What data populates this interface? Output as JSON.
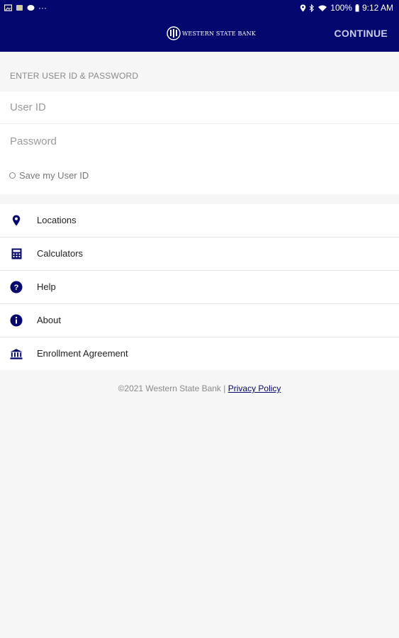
{
  "status_bar": {
    "dots": "···",
    "battery": "100%",
    "time": "9:12 AM"
  },
  "app_bar": {
    "logo_text": "WESTERN STATE BANK",
    "continue_label": "CONTINUE"
  },
  "login": {
    "section_label": "ENTER USER ID & PASSWORD",
    "user_id_placeholder": "User ID",
    "user_id_value": "",
    "password_placeholder": "Password",
    "password_value": "",
    "save_user_id_label": "Save my User ID"
  },
  "menu": {
    "items": [
      {
        "label": "Locations",
        "icon": "location-pin-icon"
      },
      {
        "label": "Calculators",
        "icon": "calculator-icon"
      },
      {
        "label": "Help",
        "icon": "help-circle-icon"
      },
      {
        "label": "About",
        "icon": "info-circle-icon"
      },
      {
        "label": "Enrollment Agreement",
        "icon": "bank-building-icon"
      }
    ]
  },
  "footer": {
    "copyright": "©2021 Western State Bank |",
    "privacy_link": "Privacy Policy"
  },
  "colors": {
    "brand_navy": "#04086e",
    "background": "#f6f6f6",
    "muted_text": "#8a8a8a"
  }
}
